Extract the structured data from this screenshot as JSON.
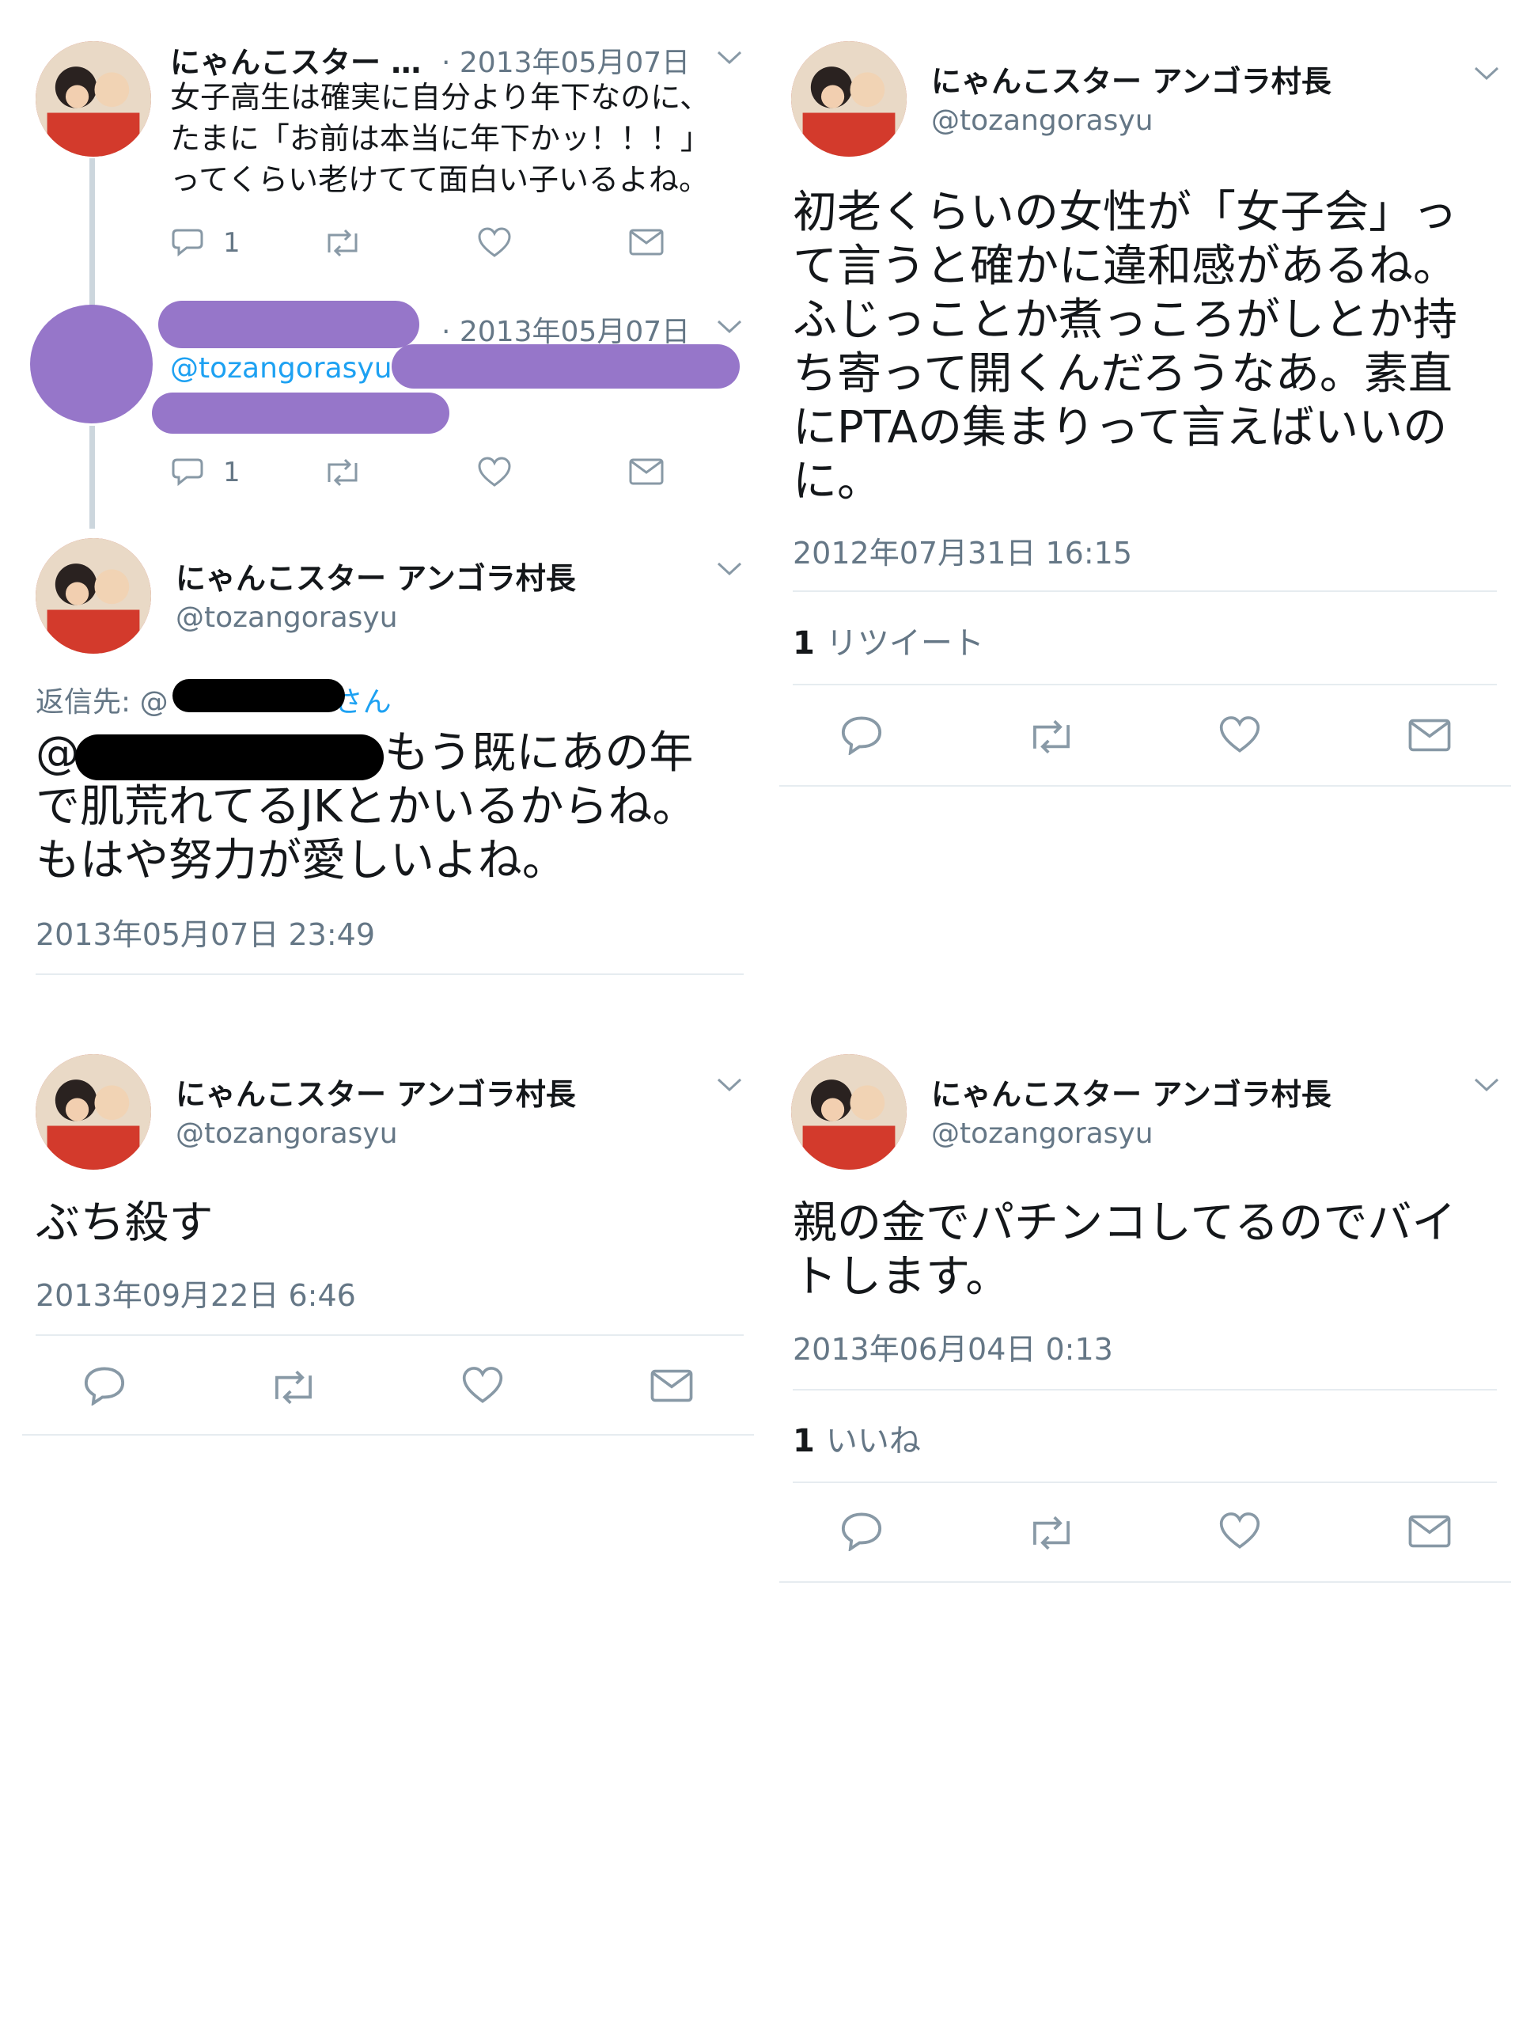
{
  "account": {
    "name": "にゃんこスター アンゴラ村長",
    "name_truncated": "にゃんこスター …",
    "handle": "@tozangorasyu"
  },
  "thread": {
    "tweet1": {
      "date": "· 2013年05月07日",
      "lines": [
        "女子高生は確実に自分より年下なのに、",
        "たまに「お前は本当に年下かッ！！！」",
        "ってくらい老けてて面白い子いるよね。"
      ],
      "reply_count": "1"
    },
    "tweet2": {
      "date": "· 2013年05月07日",
      "mention": "@tozangorasyu",
      "reply_count": "1"
    },
    "tweet3": {
      "reply_prefix": "返信先: @",
      "reply_suffix": "さん",
      "at": "@",
      "line1": "もう既にあの年",
      "line2": "で肌荒れてるJKとかいるからね。",
      "line3": "もはや努力が愛しいよね。",
      "timestamp": "2013年05月07日 23:49"
    }
  },
  "tweet_pta": {
    "lines": [
      "初老くらいの女性が「女子会」っ",
      "て言うと確かに違和感があるね。",
      "ふじっことか煮っころがしとか持",
      "ち寄って開くんだろうなあ。素直",
      "にPTAの集まりって言えばいいの",
      "に。"
    ],
    "timestamp": "2012年07月31日 16:15",
    "stat_count": "1",
    "stat_label": "リツイート"
  },
  "tweet_kill": {
    "text": "ぶち殺す",
    "timestamp": "2013年09月22日 6:46"
  },
  "tweet_pachinko": {
    "lines": [
      "親の金でパチンコしてるのでバイ",
      "トします。"
    ],
    "timestamp": "2013年06月04日 0:13",
    "stat_count": "1",
    "stat_label": "いいね"
  },
  "icons": [
    "reply-icon",
    "retweet-icon",
    "like-icon",
    "message-icon",
    "chevron-down-icon"
  ],
  "colors": {
    "handle_gray": "#657786",
    "link_blue": "#1da1f2",
    "redact_purple": "#9676c9",
    "avatar_red": "#c9382e"
  }
}
